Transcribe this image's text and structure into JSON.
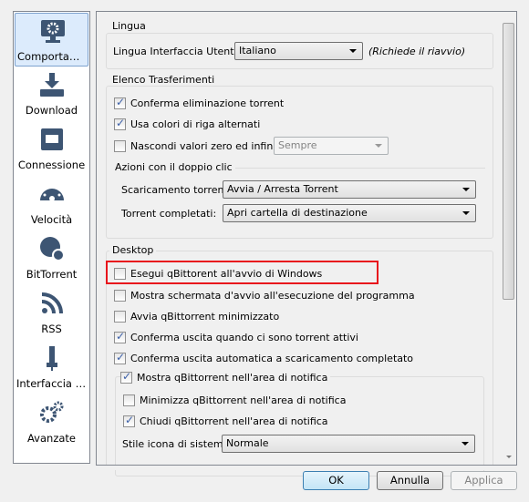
{
  "sidebar": {
    "items": [
      {
        "label": "Comportam...",
        "icon": "monitor-gear-icon",
        "selected": true
      },
      {
        "label": "Download",
        "icon": "download-icon"
      },
      {
        "label": "Connessione",
        "icon": "ethernet-icon"
      },
      {
        "label": "Velocità",
        "icon": "speedometer-icon"
      },
      {
        "label": "BitTorrent",
        "icon": "globe-gear-icon"
      },
      {
        "label": "RSS",
        "icon": "rss-icon"
      },
      {
        "label": "Interfaccia w...",
        "icon": "web-ui-icon"
      },
      {
        "label": "Avanzate",
        "icon": "gears-icon"
      }
    ]
  },
  "lingua": {
    "title": "Lingua",
    "label": "Lingua Interfaccia Utente:",
    "value": "Italiano",
    "note": "(Richiede il riavvio)"
  },
  "transfers": {
    "title": "Elenco Trasferimenti",
    "confirm_delete": {
      "label": "Conferma eliminazione torrent",
      "checked": true
    },
    "alt_rows": {
      "label": "Usa colori di riga alternati",
      "checked": true
    },
    "hide_zero": {
      "label": "Nascondi valori zero ed infinito",
      "checked": false,
      "combo": "Sempre"
    },
    "dblclick": {
      "title": "Azioni con il doppio clic",
      "downloading_label": "Scaricamento torrent:",
      "downloading_value": "Avvia / Arresta Torrent",
      "completed_label": "Torrent completati:",
      "completed_value": "Apri cartella di destinazione"
    }
  },
  "desktop": {
    "title": "Desktop",
    "items": [
      {
        "label": "Esegui qBittorent all'avvio di Windows",
        "checked": false,
        "highlighted": true
      },
      {
        "label": "Mostra schermata d'avvio all'esecuzione del programma",
        "checked": false
      },
      {
        "label": "Avvia qBittorrent minimizzato",
        "checked": false
      },
      {
        "label": "Conferma uscita quando ci sono torrent attivi",
        "checked": true
      },
      {
        "label": "Conferma uscita automatica a scaricamento completato",
        "checked": true
      }
    ],
    "tray": {
      "label": "Mostra qBittorrent nell'area di notifica",
      "checked": true,
      "minimize": {
        "label": "Minimizza qBittorrent nell'area di notifica",
        "checked": false
      },
      "close": {
        "label": "Chiudi qBittorrent nell'area di notifica",
        "checked": true
      },
      "style_label": "Stile icona di sistema:",
      "style_value": "Normale"
    }
  },
  "buttons": {
    "ok": "OK",
    "cancel": "Annulla",
    "apply": "Applica"
  },
  "colors": {
    "icon": "#3d5573",
    "highlight": "#e8141c",
    "selected": "#dcebfc"
  }
}
